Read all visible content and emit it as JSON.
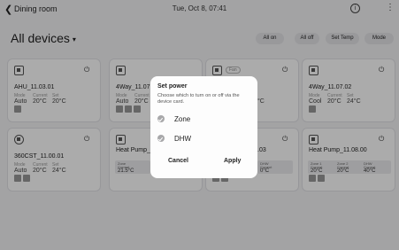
{
  "topbar": {
    "back_glyph": "❮",
    "room": "Dining room",
    "datetime": "Tue, Oct 8, 07:41",
    "info_glyph": "i",
    "more_glyph": "⋮"
  },
  "title": "All devices",
  "title_caret": "▾",
  "actions": [
    "All on",
    "All off",
    "Set Temp",
    "Mode"
  ],
  "power_glyph": "⏻",
  "labels": {
    "mode": "Mode",
    "current": "Current",
    "set": "Set",
    "zone": "Zone",
    "zone1": "Zone 1",
    "zone2": "Zone 2",
    "dhw": "DHW"
  },
  "cards": {
    "ahu": {
      "name": "AHU_11.03.01",
      "mode": "Auto",
      "current": "20°C",
      "set": "20°C"
    },
    "fourway_a": {
      "name": "4Way_11.07.",
      "mode": "Auto",
      "current": "20°C"
    },
    "card3": {
      "tag": "Fan",
      "partial": "°C"
    },
    "fourway_b": {
      "name": "4Way_11.07.02",
      "mode": "Cool",
      "current": "20°C",
      "set": "24°C"
    },
    "cst": {
      "name": "360CST_11.00.01",
      "mode": "Auto",
      "current": "20°C",
      "set": "24°C"
    },
    "heatpump_a": {
      "name": "Heat Pump_1",
      "zone_current": "21.5°C"
    },
    "card7": {
      "name": ".03",
      "dhw_current": "0°C"
    },
    "heatpump_b": {
      "name": "Heat Pump_11.08.00",
      "zone1": "20°C",
      "zone2": "20°C",
      "dhw": "40°C"
    }
  },
  "dialog": {
    "title": "Set power",
    "desc": "Choose which to turn on or off via the device card.",
    "options": [
      "Zone",
      "DHW"
    ],
    "cancel": "Cancel",
    "apply": "Apply"
  },
  "colors": {
    "scrim": "#000000",
    "card": "#ffffff",
    "background": "#f3f3f5"
  }
}
